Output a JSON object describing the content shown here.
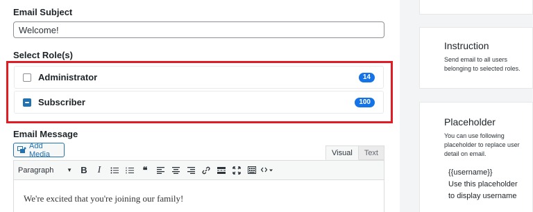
{
  "subject": {
    "label": "Email Subject",
    "value": "Welcome!"
  },
  "roles": {
    "label": "Select Role(s)",
    "items": [
      {
        "name": "Administrator",
        "count": "14",
        "checked": false
      },
      {
        "name": "Subscriber",
        "count": "100",
        "checked": true
      }
    ]
  },
  "message": {
    "label": "Email Message",
    "add_media": "Add Media",
    "tabs": [
      "Visual",
      "Text"
    ],
    "format": "Paragraph",
    "toolbar_icons": [
      "bold-icon",
      "italic-icon",
      "bullet-list-icon",
      "numbered-list-icon",
      "blockquote-icon",
      "align-left-icon",
      "align-center-icon",
      "align-right-icon",
      "link-icon",
      "read-more-icon",
      "fullscreen-icon",
      "toolbar-toggle-icon",
      "code-icon"
    ],
    "body": "We're excited that you're joining our family!"
  },
  "sidebar": {
    "instruction": {
      "title": "Instruction",
      "text": "Send email to all users belonging to selected roles."
    },
    "placeholder": {
      "title": "Placeholder",
      "text": "You can use following placeholder to replace user detail on email.",
      "token": "{{username}}",
      "hint_line1": "Use this placeholder",
      "hint_line2": "to display username"
    }
  },
  "colors": {
    "badge": "#1473e6",
    "highlight": "#e01b24",
    "checkbox_checked": "#2271b1"
  }
}
